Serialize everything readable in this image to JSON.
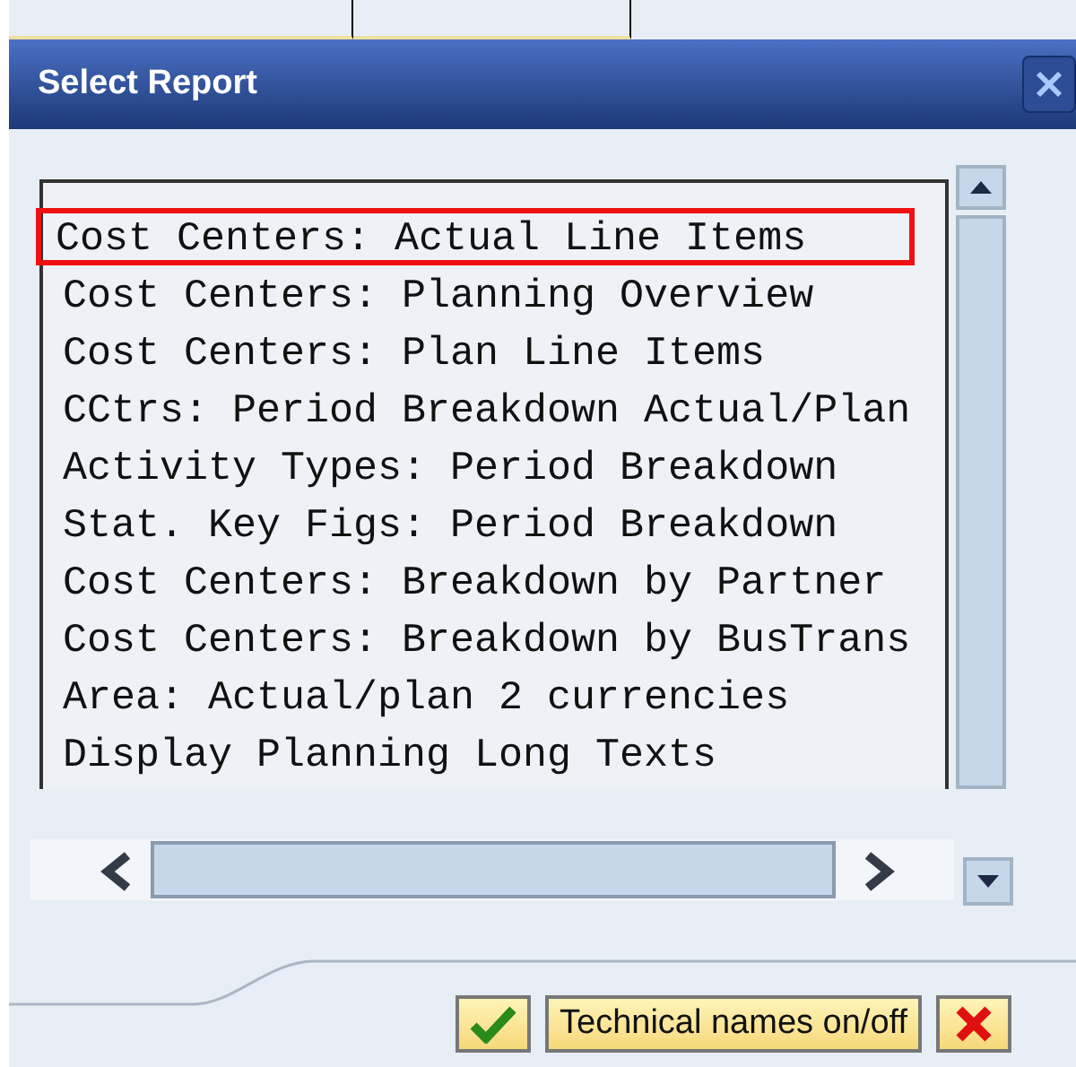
{
  "window": {
    "title": "Select Report"
  },
  "reports": [
    {
      "label": "Cost Centers: Actual Line Items",
      "selected": true
    },
    {
      "label": "Cost Centers: Planning Overview",
      "selected": false
    },
    {
      "label": "Cost Centers: Plan Line Items",
      "selected": false
    },
    {
      "label": "CCtrs: Period Breakdown Actual/Plan",
      "selected": false
    },
    {
      "label": "Activity Types: Period Breakdown",
      "selected": false
    },
    {
      "label": "Stat. Key Figs: Period Breakdown",
      "selected": false
    },
    {
      "label": "Cost Centers: Breakdown by Partner",
      "selected": false
    },
    {
      "label": "Cost Centers: Breakdown by BusTrans",
      "selected": false
    },
    {
      "label": "Area: Actual/plan 2 currencies",
      "selected": false
    },
    {
      "label": "Display Planning Long Texts",
      "selected": false
    }
  ],
  "buttons": [
    {
      "kind": "confirm"
    },
    {
      "kind": "text",
      "label": "Technical names on/off"
    },
    {
      "kind": "cancel"
    }
  ]
}
